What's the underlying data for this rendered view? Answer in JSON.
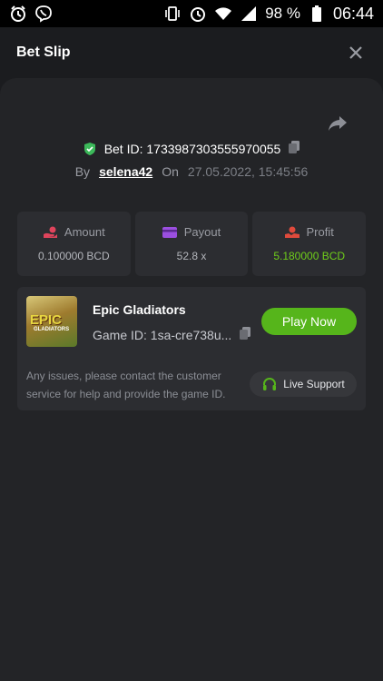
{
  "status_bar": {
    "battery": "98 %",
    "time": "06:44"
  },
  "header": {
    "title": "Bet Slip"
  },
  "bet": {
    "id_label": "Bet ID: 1733987303555970055",
    "by_label": "By",
    "username": "selena42",
    "on_label": "On",
    "datetime": "27.05.2022, 15:45:56"
  },
  "stats": [
    {
      "label": "Amount",
      "value": "0.100000 BCD",
      "icon": "money-hand-icon",
      "color": "#e0445c"
    },
    {
      "label": "Payout",
      "value": "52.8 x",
      "icon": "wallet-card-icon",
      "color": "#9b4fe0"
    },
    {
      "label": "Profit",
      "value": "5.180000 BCD",
      "icon": "profit-icon",
      "color": "#e04a3c"
    }
  ],
  "game": {
    "name": "Epic Gladiators",
    "id_label": "Game ID: 1sa-cre738u...",
    "play_label": "Play Now",
    "thumb_word": "EPIC",
    "thumb_sub": "GLADIATORS"
  },
  "support": {
    "text": "Any issues, please contact the customer service for help and provide the game ID.",
    "button_label": "Live Support"
  },
  "colors": {
    "accent_green": "#56b51b",
    "profit_green": "#6fce1a",
    "verified_green": "#3cb95a"
  }
}
